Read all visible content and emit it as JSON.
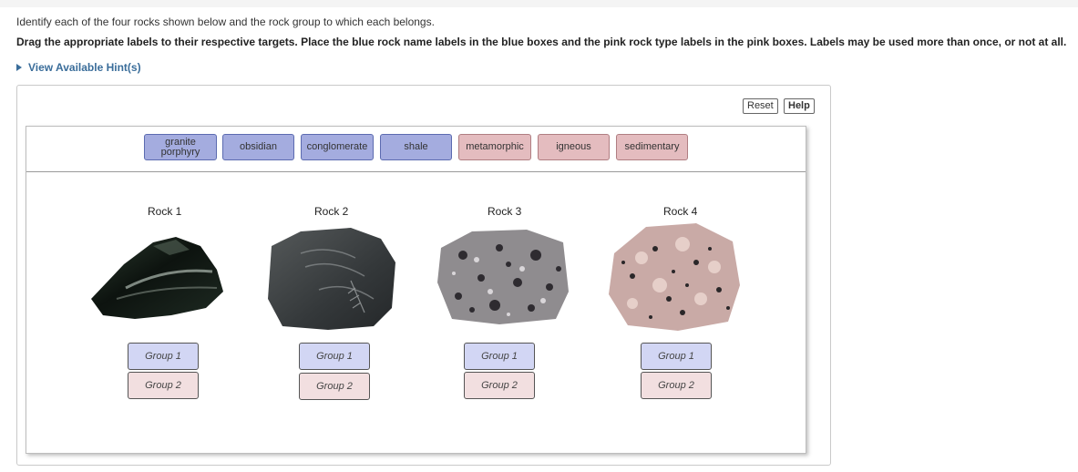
{
  "instructions": {
    "line1": "Identify each of the four rocks shown below and the rock group to which each belongs.",
    "line2": "Drag the appropriate labels to their respective targets. Place the blue rock name labels in the blue boxes and the pink rock type labels in the pink boxes. Labels may be used more than once, or not at all.",
    "hint_link": "View Available Hint(s)"
  },
  "controls": {
    "reset": "Reset",
    "help": "Help"
  },
  "labels": {
    "granite": "granite porphyry",
    "obsidian": "obsidian",
    "conglomerate": "conglomerate",
    "shale": "shale",
    "metamorphic": "metamorphic",
    "igneous": "igneous",
    "sedimentary": "sedimentary"
  },
  "rocks": [
    {
      "title": "Rock 1",
      "group1": "Group 1",
      "group2": "Group 2"
    },
    {
      "title": "Rock 2",
      "group1": "Group 1",
      "group2": "Group 2"
    },
    {
      "title": "Rock 3",
      "group1": "Group 1",
      "group2": "Group 2"
    },
    {
      "title": "Rock 4",
      "group1": "Group 1",
      "group2": "Group 2"
    }
  ],
  "colors": {
    "blue_label": "#a4acdf",
    "pink_label": "#e4bcbf",
    "blue_target": "#d2d6f4",
    "pink_target": "#f2dfe0",
    "hint_link": "#3a6d9a"
  }
}
